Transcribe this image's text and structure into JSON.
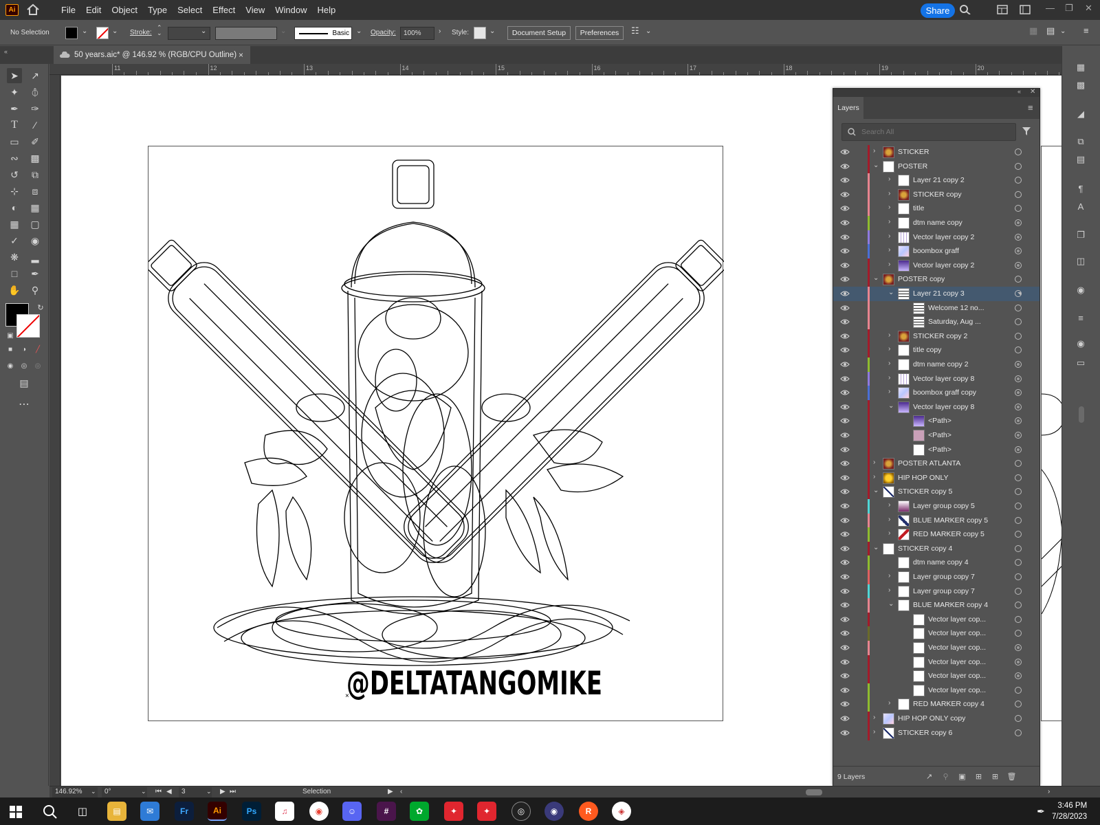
{
  "app": {
    "logo": "Ai"
  },
  "menu": [
    "File",
    "Edit",
    "Object",
    "Type",
    "Select",
    "Effect",
    "View",
    "Window",
    "Help"
  ],
  "share_label": "Share",
  "control": {
    "selection": "No Selection",
    "stroke_label": "Stroke:",
    "brush": "Basic",
    "opacity_label": "Opacity:",
    "opacity_value": "100%",
    "style_label": "Style:",
    "doc_setup": "Document Setup",
    "preferences": "Preferences"
  },
  "document": {
    "tab_title": "50 years.aic* @ 146.92 % (RGB/CPU Outline)",
    "close": "×"
  },
  "ruler": {
    "top": [
      "11",
      "12",
      "13",
      "14",
      "15",
      "16",
      "17",
      "18",
      "19",
      "20"
    ]
  },
  "artwork": {
    "handle": "@DELTATANGOMIKE"
  },
  "layers": {
    "tab": "Layers",
    "search_placeholder": "Search All",
    "count": "9 Layers",
    "rows": [
      {
        "name": "STICKER",
        "level": 0,
        "expand": ">",
        "color": "#a31b2a",
        "thumb": "sticker",
        "filled": false
      },
      {
        "name": "POSTER",
        "level": 0,
        "expand": "v",
        "color": "#a31b2a",
        "thumb": "white",
        "filled": false
      },
      {
        "name": "Layer 21 copy 2",
        "level": 1,
        "expand": ">",
        "color": "#e8848f",
        "thumb": "white",
        "filled": false
      },
      {
        "name": "STICKER copy",
        "level": 1,
        "expand": ">",
        "color": "#e8848f",
        "thumb": "sticker",
        "filled": false
      },
      {
        "name": "title",
        "level": 1,
        "expand": ">",
        "color": "#e8848f",
        "thumb": "white",
        "filled": false
      },
      {
        "name": "dtm name copy",
        "level": 1,
        "expand": ">",
        "color": "#8fbc2e",
        "thumb": "white",
        "filled": true
      },
      {
        "name": "Vector layer copy 2",
        "level": 1,
        "expand": ">",
        "color": "#8f7ae0",
        "thumb": "lines",
        "filled": true
      },
      {
        "name": "boombox graff",
        "level": 1,
        "expand": ">",
        "color": "#4a6fd6",
        "thumb": "graff",
        "filled": true
      },
      {
        "name": "Vector layer copy 2",
        "level": 1,
        "expand": ">",
        "color": "#a31b2a",
        "thumb": "purple",
        "filled": true
      },
      {
        "name": "POSTER copy",
        "level": 0,
        "expand": "v",
        "color": "#a31b2a",
        "thumb": "sticker",
        "filled": false
      },
      {
        "name": "Layer 21 copy 3",
        "level": 1,
        "expand": "v",
        "color": "#e8848f",
        "thumb": "text",
        "filled": false,
        "selected": true
      },
      {
        "name": "Welcome 12 no...",
        "level": 2,
        "expand": "",
        "color": "#e8848f",
        "thumb": "text",
        "filled": false
      },
      {
        "name": "Saturday, Aug ...",
        "level": 2,
        "expand": "",
        "color": "#e8848f",
        "thumb": "text",
        "filled": false
      },
      {
        "name": "STICKER copy 2",
        "level": 1,
        "expand": ">",
        "color": "#a31b2a",
        "thumb": "sticker",
        "filled": false
      },
      {
        "name": "title copy",
        "level": 1,
        "expand": ">",
        "color": "#a31b2a",
        "thumb": "white",
        "filled": false
      },
      {
        "name": "dtm name copy 2",
        "level": 1,
        "expand": ">",
        "color": "#8fbc2e",
        "thumb": "white",
        "filled": true
      },
      {
        "name": "Vector layer copy 8",
        "level": 1,
        "expand": ">",
        "color": "#8f7ae0",
        "thumb": "lines",
        "filled": true
      },
      {
        "name": "boombox graff copy",
        "level": 1,
        "expand": ">",
        "color": "#4a6fd6",
        "thumb": "graff",
        "filled": true
      },
      {
        "name": "Vector layer copy 8",
        "level": 1,
        "expand": "v",
        "color": "#a31b2a",
        "thumb": "purple",
        "filled": true
      },
      {
        "name": "<Path>",
        "level": 2,
        "expand": "",
        "color": "#a31b2a",
        "thumb": "purple",
        "filled": true
      },
      {
        "name": "<Path>",
        "level": 2,
        "expand": "",
        "color": "#a31b2a",
        "thumb": "pink",
        "filled": true
      },
      {
        "name": "<Path>",
        "level": 2,
        "expand": "",
        "color": "#a31b2a",
        "thumb": "white",
        "filled": true
      },
      {
        "name": "POSTER ATLANTA",
        "level": 0,
        "expand": ">",
        "color": "#a31b2a",
        "thumb": "sticker",
        "filled": false
      },
      {
        "name": "HIP HOP ONLY",
        "level": 0,
        "expand": ">",
        "color": "#a31b2a",
        "thumb": "yellow",
        "filled": false
      },
      {
        "name": "STICKER copy 5",
        "level": 0,
        "expand": "v",
        "color": "#a31b2a",
        "thumb": "x",
        "filled": false
      },
      {
        "name": "Layer group copy 5",
        "level": 1,
        "expand": ">",
        "color": "#4fd6d6",
        "thumb": "figure",
        "filled": false
      },
      {
        "name": "BLUE MARKER copy 5",
        "level": 1,
        "expand": ">",
        "color": "#e8848f",
        "thumb": "bluemarker",
        "filled": false
      },
      {
        "name": "RED MARKER copy 5",
        "level": 1,
        "expand": ">",
        "color": "#8fbc2e",
        "thumb": "redmarker",
        "filled": false
      },
      {
        "name": "STICKER copy 4",
        "level": 0,
        "expand": "v",
        "color": "#a31b2a",
        "thumb": "white",
        "filled": false
      },
      {
        "name": "dtm name copy 4",
        "level": 1,
        "expand": "",
        "color": "#8fbc2e",
        "thumb": "white",
        "filled": false
      },
      {
        "name": "Layer group copy 7",
        "level": 1,
        "expand": ">",
        "color": "#e06060",
        "thumb": "white",
        "filled": false
      },
      {
        "name": "Layer group copy 7",
        "level": 1,
        "expand": ">",
        "color": "#4fd6d6",
        "thumb": "white",
        "filled": false
      },
      {
        "name": "BLUE MARKER copy 4",
        "level": 1,
        "expand": "v",
        "color": "#e8848f",
        "thumb": "white",
        "filled": false
      },
      {
        "name": "Vector layer cop...",
        "level": 2,
        "expand": "",
        "color": "#a31b2a",
        "thumb": "white",
        "filled": false
      },
      {
        "name": "Vector layer cop...",
        "level": 2,
        "expand": "",
        "color": "#6b6b2b",
        "thumb": "white",
        "filled": false
      },
      {
        "name": "Vector layer cop...",
        "level": 2,
        "expand": "",
        "color": "#e8848f",
        "thumb": "white",
        "filled": true
      },
      {
        "name": "Vector layer cop...",
        "level": 2,
        "expand": "",
        "color": "#a31b2a",
        "thumb": "white",
        "filled": true
      },
      {
        "name": "Vector layer cop...",
        "level": 2,
        "expand": "",
        "color": "#a31b2a",
        "thumb": "white",
        "filled": true
      },
      {
        "name": "Vector layer cop...",
        "level": 2,
        "expand": "",
        "color": "#8fbc2e",
        "thumb": "white",
        "filled": false
      },
      {
        "name": "RED MARKER copy 4",
        "level": 1,
        "expand": ">",
        "color": "#8fbc2e",
        "thumb": "white",
        "filled": false
      },
      {
        "name": "HIP HOP ONLY copy",
        "level": 0,
        "expand": ">",
        "color": "#a31b2a",
        "thumb": "graff",
        "filled": false
      },
      {
        "name": "STICKER copy 6",
        "level": 0,
        "expand": ">",
        "color": "#a31b2a",
        "thumb": "x",
        "filled": false
      }
    ]
  },
  "status": {
    "zoom": "146.92%",
    "rotation": "0°",
    "artboard": "3",
    "tool": "Selection"
  },
  "taskbar": {
    "time": "3:46 PM",
    "date": "7/28/2023"
  }
}
